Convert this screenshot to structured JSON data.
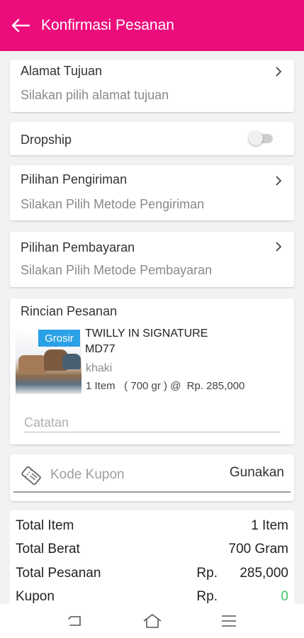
{
  "header": {
    "title": "Konfirmasi Pesanan"
  },
  "address": {
    "label": "Alamat Tujuan",
    "placeholder": "Silakan pilih alamat tujuan"
  },
  "dropship": {
    "label": "Dropship"
  },
  "shipping": {
    "label": "Pilihan Pengiriman",
    "placeholder": "Silakan Pilih Metode Pengiriman"
  },
  "payment": {
    "label": "Pilihan Pembayaran",
    "placeholder": "Silakan Pilih Metode Pembayaran"
  },
  "order": {
    "title": "Rincian Pesanan",
    "item": {
      "badge": "Grosir",
      "name_line1": "TWILLY IN SIGNATURE",
      "name_line2": "MD77",
      "variant": "khaki",
      "qty_text": "1 Item   ( 700 gr ) @",
      "price": "Rp. 285,000"
    },
    "note_placeholder": "Catatan"
  },
  "coupon": {
    "placeholder": "Kode Kupon",
    "button": "Gunakan"
  },
  "summary": {
    "total_item_label": "Total Item",
    "total_item_value": "1 Item",
    "total_weight_label": "Total Berat",
    "total_weight_value": "700 Gram",
    "total_order_label": "Total Pesanan",
    "total_order_currency": "Rp.",
    "total_order_value": "285,000",
    "coupon_label": "Kupon",
    "coupon_currency": "Rp.",
    "coupon_value": "0"
  },
  "colors": {
    "brand": "#ec0c7c",
    "badge": "#2aa0e6",
    "discount": "#43c068"
  },
  "icons": [
    "back-arrow-icon",
    "chevron-right-icon",
    "coupon-ticket-icon",
    "nav-back-icon",
    "nav-home-icon",
    "nav-menu-icon"
  ]
}
